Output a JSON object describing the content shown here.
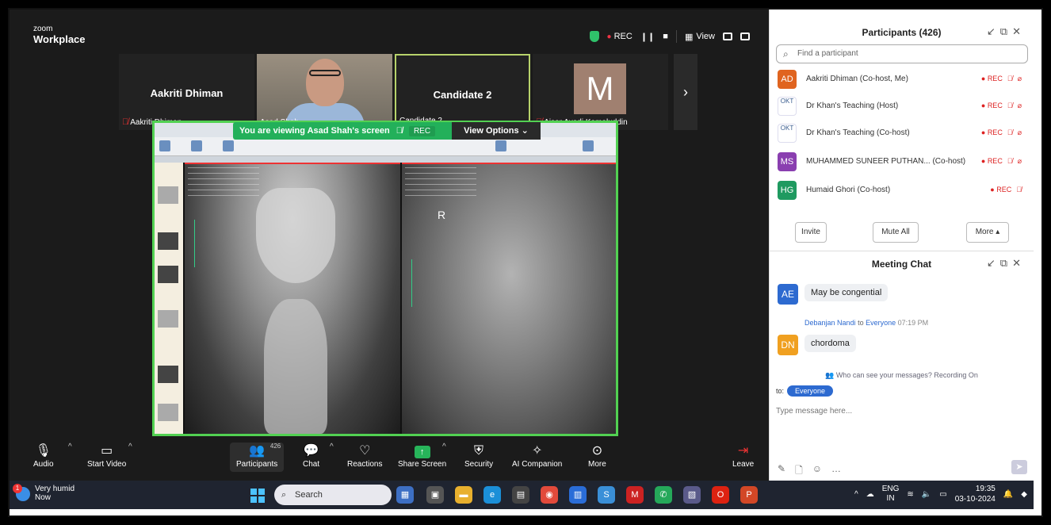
{
  "zoom": {
    "logo_small": "zoom",
    "logo_big": "Workplace",
    "rec_label": "REC",
    "view_label": "View"
  },
  "tiles": [
    {
      "name": "Aakriti Dhiman",
      "label": "Aakriti Dhiman"
    },
    {
      "name": "",
      "label": "Asad Shah"
    },
    {
      "name": "Candidate 2",
      "label": "Candidate 2"
    },
    {
      "name": "M",
      "label": "Aisar Ayadi Kamaluddin"
    }
  ],
  "share": {
    "viewing_text": "You are viewing  Asad Shah's screen",
    "rec_label": "REC",
    "view_options": "View Options",
    "marker": "R"
  },
  "toolbar": {
    "audio": "Audio",
    "start_video": "Start Video",
    "participants": "Participants",
    "participants_count": "426",
    "chat": "Chat",
    "reactions": "Reactions",
    "share_screen": "Share Screen",
    "security": "Security",
    "ai_companion": "AI Companion",
    "more": "More",
    "leave": "Leave"
  },
  "participants_panel": {
    "title": "Participants (426)",
    "search_placeholder": "Find a participant",
    "rows": [
      {
        "initials": "AD",
        "color": "#e0641f",
        "name": "Aakriti Dhiman (Co-host, Me)",
        "rec": "REC"
      },
      {
        "initials": "OKT",
        "color": "#ffffff",
        "name": "Dr Khan's Teaching (Host)",
        "rec": "REC"
      },
      {
        "initials": "OKT",
        "color": "#ffffff",
        "name": "Dr Khan's Teaching (Co-host)",
        "rec": "REC"
      },
      {
        "initials": "MS",
        "color": "#8a3fb0",
        "name": "MUHAMMED SUNEER PUTHAN... (Co-host)",
        "rec": "REC"
      },
      {
        "initials": "HG",
        "color": "#1f9a60",
        "name": "Humaid Ghori (Co-host)",
        "rec": "REC"
      }
    ],
    "invite": "Invite",
    "mute_all": "Mute All",
    "more": "More"
  },
  "chat_panel": {
    "title": "Meeting Chat",
    "messages": [
      {
        "initials": "AE",
        "color": "#2d6ad0",
        "text": "May be congential"
      },
      {
        "initials": "DN",
        "color": "#f0a020",
        "sender": "Debanjan Nandi",
        "to_word": "to",
        "recipient": "Everyone",
        "time": "07:19 PM",
        "text": "chordoma"
      }
    ],
    "who_sees": "Who can see your messages? Recording On",
    "to_label": "to:",
    "to_target": "Everyone",
    "input_placeholder": "Type message here..."
  },
  "taskbar": {
    "weather_title": "Very humid",
    "weather_sub": "Now",
    "weather_badge": "1",
    "search": "Search",
    "lang_top": "ENG",
    "lang_bottom": "IN",
    "time": "19:35",
    "date": "03-10-2024"
  }
}
